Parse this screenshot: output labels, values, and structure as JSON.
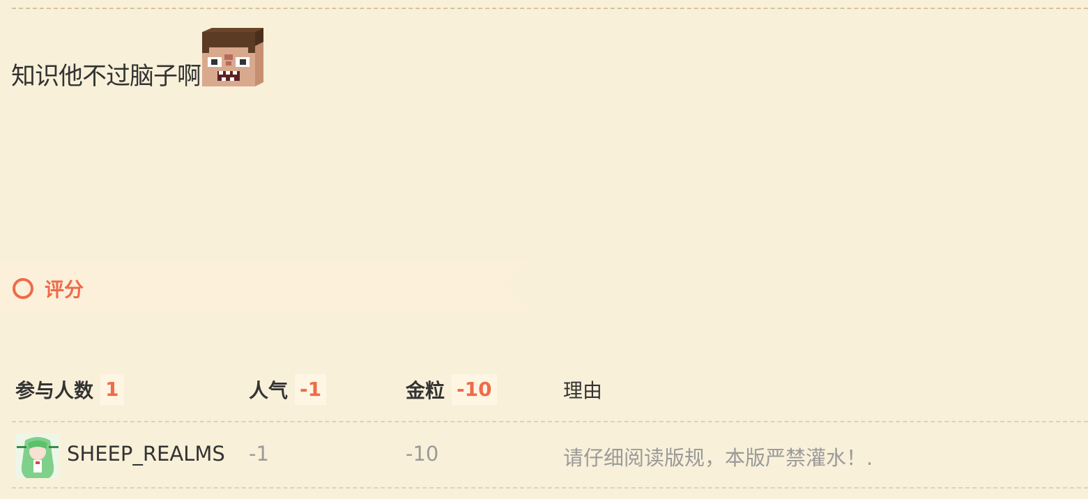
{
  "post": {
    "text": "知识他不过脑子啊",
    "emoji_icon": "pixel-steve-face"
  },
  "rating": {
    "title": "评分",
    "icon": "ring-icon",
    "accent_color": "#ee6b4a",
    "headers": {
      "participants_label": "参与人数",
      "participants_value": "1",
      "popularity_label": "人气",
      "popularity_value": "-1",
      "gold_label": "金粒",
      "gold_value": "-10",
      "reason_label": "理由"
    },
    "rows": [
      {
        "user": "SHEEP_REALMS",
        "popularity": "-1",
        "gold": "-10",
        "reason": "请仔细阅读版规，本版严禁灌水！."
      }
    ]
  }
}
